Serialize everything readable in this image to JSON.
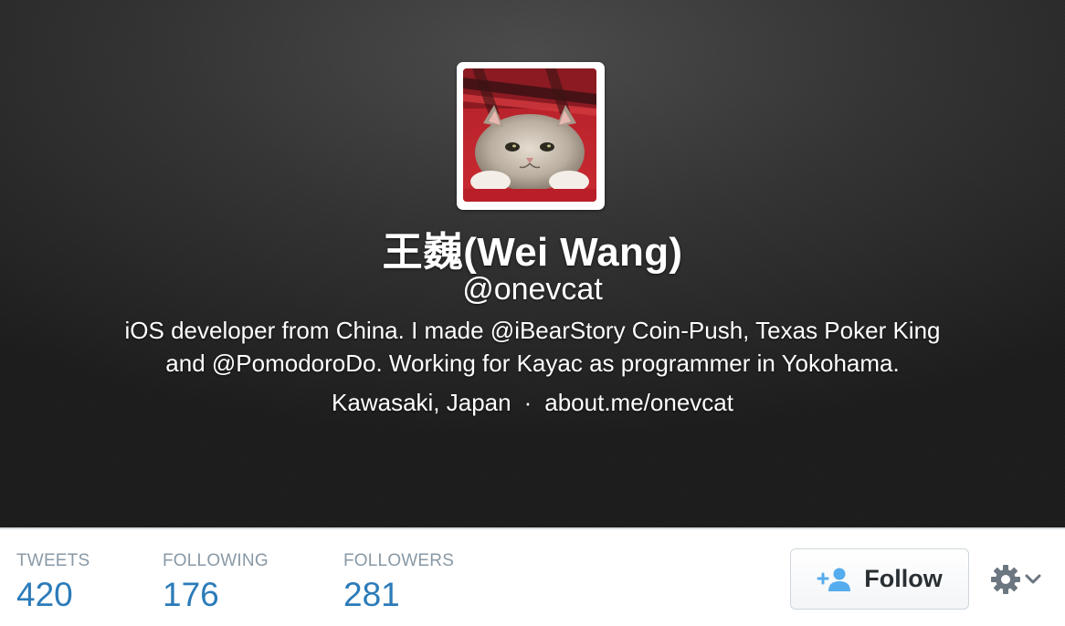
{
  "profile": {
    "full_name": "王巍(Wei Wang)",
    "screen_name": "@onevcat",
    "bio_line1": "iOS developer from China. I made @iBearStory Coin-Push, Texas Poker King",
    "bio_line2": "and @PomodoroDo. Working for Kayac as programmer in Yokohama.",
    "location": "Kawasaki, Japan",
    "separator": "·",
    "website": "about.me/onevcat"
  },
  "stats": {
    "tweets_label": "TWEETS",
    "tweets_value": "420",
    "following_label": "FOLLOWING",
    "following_value": "176",
    "followers_label": "FOLLOWERS",
    "followers_value": "281"
  },
  "actions": {
    "follow_label": "Follow"
  },
  "icons": {
    "follow": "add-user-icon",
    "settings": "gear-icon",
    "dropdown": "chevron-down-icon"
  },
  "colors": {
    "stat_value": "#2b7bb9",
    "stat_label": "#8899a6",
    "follow_icon": "#55acee"
  }
}
